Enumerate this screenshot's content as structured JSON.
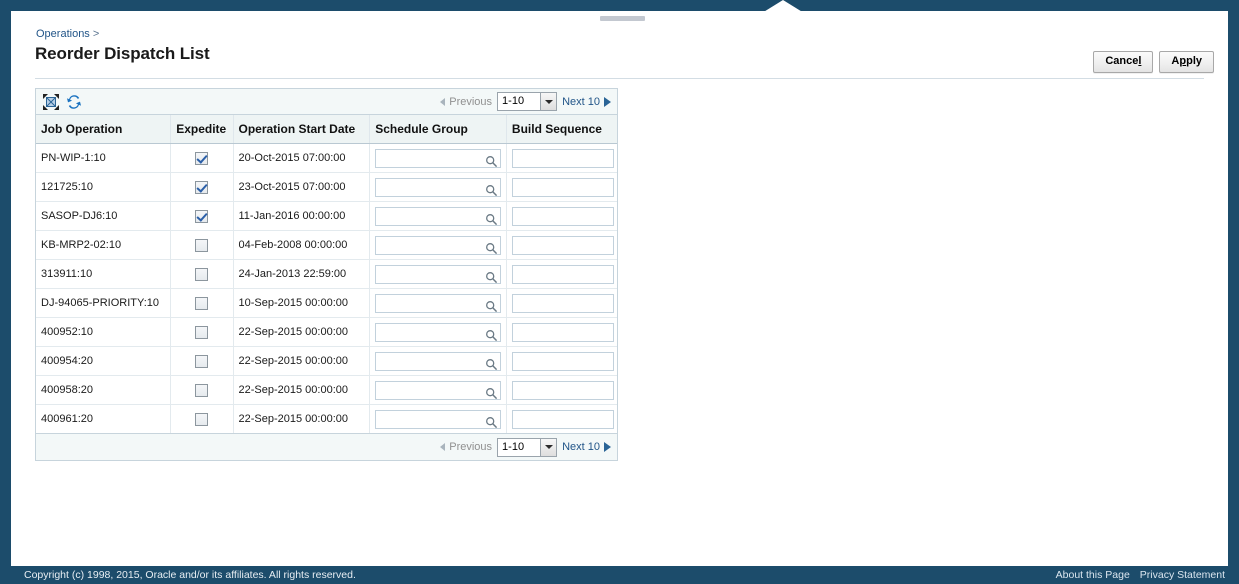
{
  "breadcrumb": {
    "items": [
      {
        "label": "Operations",
        "is_link": true
      }
    ],
    "separator": ">"
  },
  "page_title": "Reorder Dispatch List",
  "action_buttons": {
    "cancel": {
      "label_before": "Cance",
      "access_key": "l",
      "label_after": ""
    },
    "apply": {
      "label_before": "A",
      "access_key": "p",
      "label_after": "ply"
    }
  },
  "toolbar": {
    "expand_icon": "expand-collapse-icon",
    "refresh_icon": "refresh-icon"
  },
  "pagination": {
    "previous_label": "Previous",
    "previous_enabled": false,
    "range_value": "1-10",
    "next_label": "Next 10",
    "next_enabled": true
  },
  "table": {
    "columns": [
      {
        "key": "job_operation",
        "label": "Job Operation"
      },
      {
        "key": "expedite",
        "label": "Expedite"
      },
      {
        "key": "operation_start_date",
        "label": "Operation Start Date"
      },
      {
        "key": "schedule_group",
        "label": "Schedule Group"
      },
      {
        "key": "build_sequence",
        "label": "Build Sequence"
      }
    ],
    "rows": [
      {
        "job_operation": "PN-WIP-1:10",
        "expedite": true,
        "operation_start_date": "20-Oct-2015 07:00:00",
        "schedule_group": "",
        "build_sequence": ""
      },
      {
        "job_operation": "121725:10",
        "expedite": true,
        "operation_start_date": "23-Oct-2015 07:00:00",
        "schedule_group": "",
        "build_sequence": ""
      },
      {
        "job_operation": "SASOP-DJ6:10",
        "expedite": true,
        "operation_start_date": "11-Jan-2016 00:00:00",
        "schedule_group": "",
        "build_sequence": ""
      },
      {
        "job_operation": "KB-MRP2-02:10",
        "expedite": false,
        "operation_start_date": "04-Feb-2008 00:00:00",
        "schedule_group": "",
        "build_sequence": ""
      },
      {
        "job_operation": "313911:10",
        "expedite": false,
        "operation_start_date": "24-Jan-2013 22:59:00",
        "schedule_group": "",
        "build_sequence": ""
      },
      {
        "job_operation": "DJ-94065-PRIORITY:10",
        "expedite": false,
        "operation_start_date": "10-Sep-2015 00:00:00",
        "schedule_group": "",
        "build_sequence": ""
      },
      {
        "job_operation": "400952:10",
        "expedite": false,
        "operation_start_date": "22-Sep-2015 00:00:00",
        "schedule_group": "",
        "build_sequence": ""
      },
      {
        "job_operation": "400954:20",
        "expedite": false,
        "operation_start_date": "22-Sep-2015 00:00:00",
        "schedule_group": "",
        "build_sequence": ""
      },
      {
        "job_operation": "400958:20",
        "expedite": false,
        "operation_start_date": "22-Sep-2015 00:00:00",
        "schedule_group": "",
        "build_sequence": ""
      },
      {
        "job_operation": "400961:20",
        "expedite": false,
        "operation_start_date": "22-Sep-2015 00:00:00",
        "schedule_group": "",
        "build_sequence": ""
      }
    ]
  },
  "footer": {
    "copyright": "Copyright (c) 1998, 2015, Oracle and/or its affiliates. All rights reserved.",
    "links": [
      {
        "label": "About this Page"
      },
      {
        "label": "Privacy Statement"
      }
    ]
  },
  "colors": {
    "chrome": "#1c4c6b",
    "link": "#225588",
    "header_bg": "#eef4f4",
    "bar_bg": "#f3f8f8",
    "border": "#c7d4dc"
  }
}
